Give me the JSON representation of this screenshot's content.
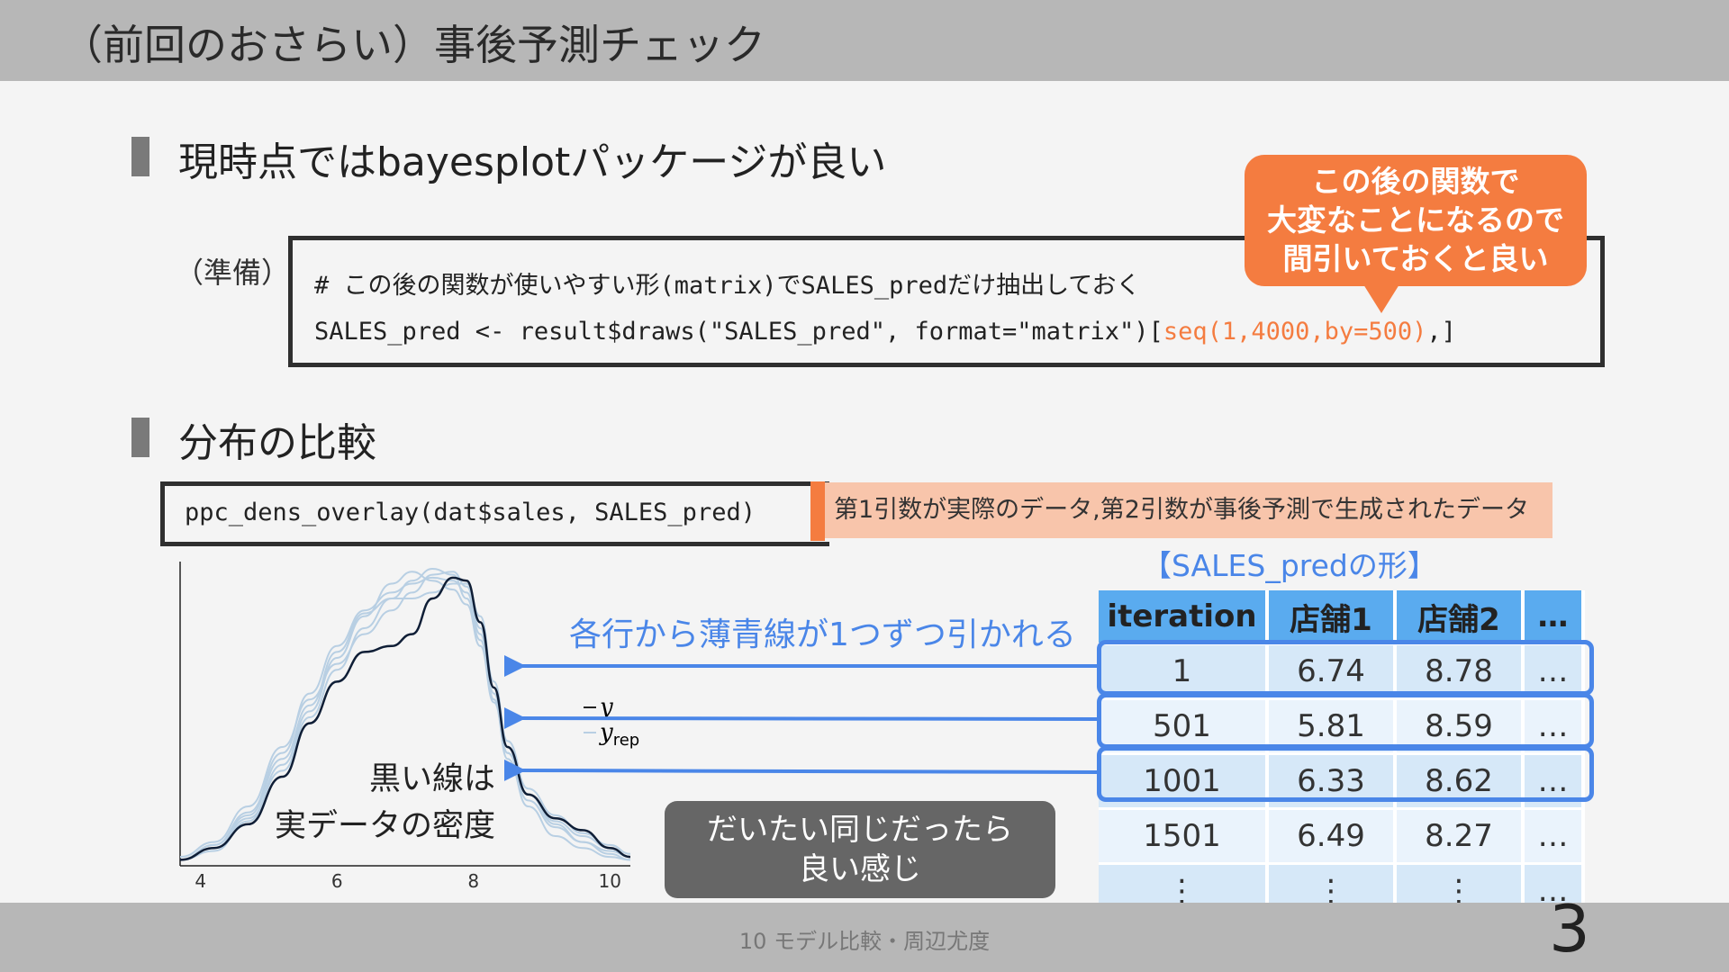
{
  "title": "（前回のおさらい）事後予測チェック",
  "section1": {
    "heading": "現時点ではbayesplotパッケージが良い",
    "prep_label": "（準備）",
    "code_comment": "# この後の関数が使いやすい形(matrix)でSALES_predだけ抽出しておく",
    "code_line_prefix": "SALES_pred <- result$draws(\"SALES_pred\", format=\"matrix\")[",
    "code_line_highlight": "seq(1,4000,by=500)",
    "code_line_suffix": ",]",
    "callout_lines": [
      "この後の関数で",
      "大変なことになるので",
      "間引いておくと良い"
    ]
  },
  "section2": {
    "heading": "分布の比較",
    "code": "ppc_dens_overlay(dat$sales, SALES_pred)",
    "note": "第1引数が実際のデータ,第2引数が事後予測で生成されたデータ",
    "shape_title": "【SALES_predの形】",
    "row_label": "各行から薄青線が1つずつ引かれる",
    "black_note_lines": [
      "黒い線は",
      "実データの密度"
    ],
    "gray_box_lines": [
      "だいたい同じだったら",
      "良い感じ"
    ]
  },
  "table": {
    "headers": [
      "iteration",
      "店舗1",
      "店舗2",
      "…"
    ],
    "rows": [
      [
        "1",
        "6.74",
        "8.78",
        "…"
      ],
      [
        "501",
        "5.81",
        "8.59",
        "…"
      ],
      [
        "1001",
        "6.33",
        "8.62",
        "…"
      ],
      [
        "1501",
        "6.49",
        "8.27",
        "…"
      ],
      [
        "⋮",
        "⋮",
        "⋮",
        "…"
      ]
    ]
  },
  "chart_data": {
    "type": "line",
    "x_ticks": [
      "4",
      "6",
      "8",
      "10"
    ],
    "xlim": [
      3.7,
      10.3
    ],
    "legend": {
      "y": "y",
      "yrep": "y",
      "yrep_sub": "rep"
    },
    "series": [
      {
        "x": [
          3.7,
          4.2,
          4.7,
          5.2,
          5.6,
          6.0,
          6.4,
          6.8,
          7.1,
          7.4,
          7.7,
          7.9,
          8.1,
          8.3,
          8.5,
          8.8,
          9.2,
          9.6,
          10.0,
          10.3
        ],
        "values": [
          0.02,
          0.06,
          0.14,
          0.3,
          0.48,
          0.62,
          0.72,
          0.74,
          0.78,
          0.9,
          0.97,
          0.96,
          0.82,
          0.6,
          0.4,
          0.24,
          0.16,
          0.12,
          0.06,
          0.03
        ]
      },
      {
        "x": [
          3.7,
          4.2,
          4.7,
          5.2,
          5.6,
          6.0,
          6.4,
          6.8,
          7.1,
          7.4,
          7.7,
          7.9,
          8.1,
          8.3,
          8.5,
          8.8,
          9.2,
          9.6,
          10.0,
          10.3
        ],
        "values": [
          0.02,
          0.07,
          0.18,
          0.38,
          0.58,
          0.74,
          0.86,
          0.92,
          0.95,
          0.97,
          0.96,
          0.92,
          0.78,
          0.56,
          0.36,
          0.2,
          0.1,
          0.06,
          0.03,
          0.02
        ]
      },
      {
        "x": [
          3.7,
          4.2,
          4.7,
          5.2,
          5.6,
          6.0,
          6.4,
          6.8,
          7.1,
          7.4,
          7.7,
          7.9,
          8.1,
          8.3,
          8.5,
          8.8,
          9.2,
          9.6,
          10.0,
          10.3
        ],
        "values": [
          0.02,
          0.05,
          0.15,
          0.34,
          0.52,
          0.7,
          0.84,
          0.95,
          0.99,
          0.96,
          0.93,
          0.88,
          0.74,
          0.55,
          0.38,
          0.24,
          0.14,
          0.08,
          0.04,
          0.02
        ]
      },
      {
        "x": [
          3.7,
          4.2,
          4.7,
          5.2,
          5.6,
          6.0,
          6.4,
          6.8,
          7.1,
          7.4,
          7.7,
          7.9,
          8.1,
          8.3,
          8.5,
          8.8,
          9.2,
          9.6,
          10.0,
          10.3
        ],
        "values": [
          0.03,
          0.08,
          0.2,
          0.4,
          0.56,
          0.68,
          0.78,
          0.86,
          0.92,
          0.98,
          0.99,
          0.94,
          0.8,
          0.58,
          0.38,
          0.22,
          0.13,
          0.08,
          0.05,
          0.03
        ]
      },
      {
        "x": [
          3.7,
          4.2,
          4.7,
          5.2,
          5.6,
          6.0,
          6.4,
          6.8,
          7.1,
          7.4,
          7.7,
          7.9,
          8.1,
          8.3,
          8.5,
          8.8,
          9.2,
          9.6,
          10.0,
          10.3
        ],
        "values": [
          0.02,
          0.06,
          0.16,
          0.32,
          0.5,
          0.66,
          0.8,
          0.9,
          0.96,
          1.0,
          0.98,
          0.9,
          0.76,
          0.56,
          0.38,
          0.24,
          0.15,
          0.1,
          0.06,
          0.03
        ]
      },
      {
        "x": [
          3.7,
          4.2,
          4.7,
          5.2,
          5.6,
          6.0,
          6.4,
          6.8,
          7.1,
          7.4,
          7.7,
          7.9,
          8.1,
          8.3,
          8.5,
          8.8,
          9.2,
          9.6,
          10.0,
          10.3
        ],
        "values": [
          0.02,
          0.07,
          0.17,
          0.36,
          0.54,
          0.72,
          0.85,
          0.9,
          0.9,
          0.92,
          0.95,
          0.95,
          0.84,
          0.62,
          0.42,
          0.26,
          0.17,
          0.11,
          0.07,
          0.04
        ]
      }
    ]
  }
}
